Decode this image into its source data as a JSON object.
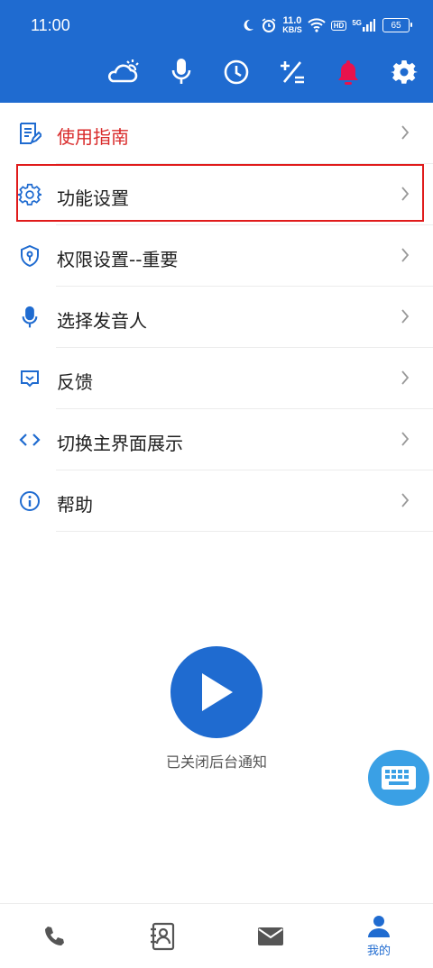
{
  "status_bar": {
    "time": "11:00",
    "net_speed_top": "11.0",
    "net_speed_bottom": "KB/S",
    "hd": "HD",
    "signal": "5G",
    "battery": "65"
  },
  "toolbar": {
    "icons": [
      "weather-icon",
      "microphone-icon",
      "clock-icon",
      "calculator-icon",
      "bell-icon",
      "gear-icon"
    ]
  },
  "menu": {
    "items": [
      {
        "label": "使用指南",
        "icon": "guide-icon"
      },
      {
        "label": "功能设置",
        "icon": "settings-gear-icon"
      },
      {
        "label": "权限设置--重要",
        "icon": "shield-icon"
      },
      {
        "label": "选择发音人",
        "icon": "microphone-icon"
      },
      {
        "label": "反馈",
        "icon": "feedback-icon"
      },
      {
        "label": "切换主界面展示",
        "icon": "code-icon"
      },
      {
        "label": "帮助",
        "icon": "info-icon"
      }
    ]
  },
  "main": {
    "notice": "已关闭后台通知"
  },
  "bottom_nav": {
    "items": [
      {
        "icon": "phone-icon",
        "label": ""
      },
      {
        "icon": "contacts-icon",
        "label": ""
      },
      {
        "icon": "mail-icon",
        "label": ""
      },
      {
        "icon": "person-icon",
        "label": "我的"
      }
    ]
  },
  "colors": {
    "primary": "#1f6bd0",
    "guide_text": "#d92b2b",
    "bell": "#e8124c",
    "keyboard_fab": "#3aa0e5",
    "highlight_border": "#e01b1b"
  }
}
